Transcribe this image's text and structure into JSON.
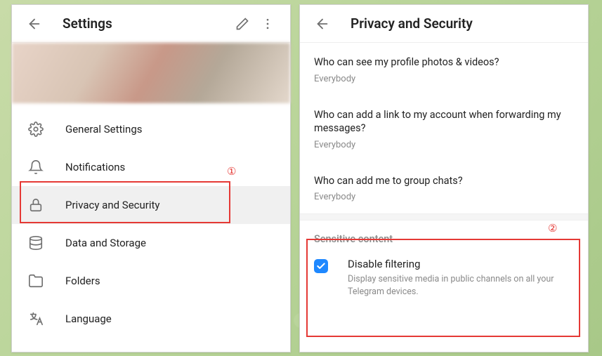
{
  "left": {
    "title": "Settings",
    "menu": [
      {
        "icon": "gear",
        "label": "General Settings"
      },
      {
        "icon": "bell",
        "label": "Notifications"
      },
      {
        "icon": "lock",
        "label": "Privacy and Security"
      },
      {
        "icon": "disk",
        "label": "Data and Storage"
      },
      {
        "icon": "folder",
        "label": "Folders"
      },
      {
        "icon": "lang",
        "label": "Language"
      }
    ]
  },
  "right": {
    "title": "Privacy and Security",
    "items": [
      {
        "q": "Who can see my profile photos & videos?",
        "a": "Everybody"
      },
      {
        "q": "Who can add a link to my account when forwarding my messages?",
        "a": "Everybody"
      },
      {
        "q": "Who can add me to group chats?",
        "a": "Everybody"
      }
    ],
    "section": {
      "title": "Sensitive content",
      "checkbox": {
        "checked": true,
        "label": "Disable filtering",
        "desc": "Display sensitive media in public channels on all your Telegram devices."
      }
    }
  },
  "callouts": {
    "one": "①",
    "two": "②"
  }
}
